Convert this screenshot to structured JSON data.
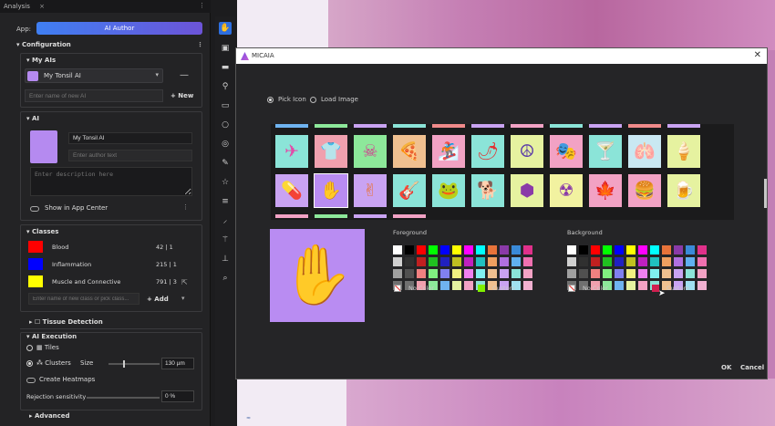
{
  "panel": {
    "title": "Analysis",
    "close": "×",
    "kebab": "⋮"
  },
  "app": {
    "label": "App:",
    "selected": "AI Author"
  },
  "configuration": {
    "title": "Configuration"
  },
  "my_ais": {
    "title": "My AIs",
    "selected_ai": "My Tonsil AI",
    "new_name_placeholder": "Enter name of new AI",
    "new_button": "+ New",
    "minus_glyph": "—"
  },
  "ai": {
    "title": "AI",
    "name_value": "My Tonsil AI",
    "author_placeholder": "Enter author text",
    "description_placeholder": "Enter description here",
    "show_in_app_center": "Show in App Center"
  },
  "classes": {
    "title": "Classes",
    "items": [
      {
        "name": "Blood",
        "count": "42 | 1",
        "color": "#ff0000"
      },
      {
        "name": "Inflammation",
        "count": "215 | 1",
        "color": "#0000ff"
      },
      {
        "name": "Muscle and Connective",
        "count": "791 | 3",
        "color": "#ffff00"
      }
    ],
    "new_class_placeholder": "Enter name of new class or pick class...",
    "add_button": "+ Add"
  },
  "tissue_detection": {
    "title": "Tissue Detection"
  },
  "ai_execution": {
    "title": "AI Execution",
    "tiles_label": "Tiles",
    "clusters_label": "Clusters",
    "size_label": "Size",
    "size_value": "130 µm",
    "heatmaps_label": "Create Heatmaps",
    "rejection_label": "Rejection sensitivity",
    "rejection_value": "0 %"
  },
  "advanced": {
    "title": "Advanced"
  },
  "dialog": {
    "title": "MICAIA",
    "close": "✕",
    "pick_icon": "Pick Icon",
    "load_image": "Load Image",
    "foreground_label": "Foreground",
    "background_label": "Background",
    "no_color": "No Color",
    "custom": "Custom",
    "ok": "OK",
    "cancel": "Cancel",
    "preview": {
      "icon": "hand-icon",
      "glyph": "✋",
      "background": "#b98cf2",
      "foreground": "#e8733a"
    },
    "strip_colors": [
      "#6fb3f0",
      "#8de89a",
      "#c9a3f2",
      "#8be4d8",
      "#f08a8a",
      "#c9a3f2",
      "#f2a2c4",
      "#8be4d8",
      "#c9a3f2",
      "#f08a8a",
      "#c9a3f2"
    ],
    "bottom_strip_colors": [
      "#f2a2c4",
      "#8de89a",
      "#c9a3f2",
      "#f2a2c4"
    ],
    "icons_row1": [
      {
        "name": "jet-icon",
        "glyph": "✈",
        "bg": "#8be4d8",
        "fg": "#e24ba8"
      },
      {
        "name": "shirt-icon",
        "glyph": "👕",
        "bg": "#f0a0ae",
        "fg": "#6dd6e0"
      },
      {
        "name": "skull-crossbones-icon",
        "glyph": "☠",
        "bg": "#8de89a",
        "fg": "#d6338f"
      },
      {
        "name": "pizza-icon",
        "glyph": "🍕",
        "bg": "#f0c090",
        "fg": "#3aa0e8"
      },
      {
        "name": "snowboarder-icon",
        "glyph": "🏂",
        "bg": "#f2a2c4",
        "fg": "#5fe0b8"
      },
      {
        "name": "chili-pepper-icon",
        "glyph": "🌶",
        "bg": "#8be4d8",
        "fg": "#e23030"
      },
      {
        "name": "peace-icon",
        "glyph": "☮",
        "bg": "#e6f2a0",
        "fg": "#5a3aa8"
      },
      {
        "name": "theater-masks-icon",
        "glyph": "🎭",
        "bg": "#f2a2c4",
        "fg": "#3ac06a"
      },
      {
        "name": "cocktail-icon",
        "glyph": "🍸",
        "bg": "#8be4d8",
        "fg": "#e02a4a"
      },
      {
        "name": "lungs-icon",
        "glyph": "🫁",
        "bg": "#c9e8f2",
        "fg": "#e0303a"
      },
      {
        "name": "ice-cream-icon",
        "glyph": "🍦",
        "bg": "#e6f2a0",
        "fg": "#c040c0"
      }
    ],
    "icons_row2": [
      {
        "name": "pills-icon",
        "glyph": "💊",
        "bg": "#c9a3f2",
        "fg": "#5ad06a"
      },
      {
        "name": "hand-icon",
        "glyph": "✋",
        "bg": "#b98cf2",
        "fg": "#3ac06a",
        "selected": true
      },
      {
        "name": "peace-hand-icon",
        "glyph": "✌",
        "bg": "#c9a3f2",
        "fg": "#e8733a"
      },
      {
        "name": "guitar-icon",
        "glyph": "🎸",
        "bg": "#8be4d8",
        "fg": "#e23030"
      },
      {
        "name": "frog-icon",
        "glyph": "🐸",
        "bg": "#8be4d8",
        "fg": "#e0308a"
      },
      {
        "name": "dog-icon",
        "glyph": "🐕",
        "bg": "#8be4d8",
        "fg": "#e23030"
      },
      {
        "name": "cubes-icon",
        "glyph": "⬢",
        "bg": "#e6f2a0",
        "fg": "#8a3aa8"
      },
      {
        "name": "radiation-icon",
        "glyph": "☢",
        "bg": "#f2f2a0",
        "fg": "#8a3aa8"
      },
      {
        "name": "cannabis-icon",
        "glyph": "🍁",
        "bg": "#f2a2c4",
        "fg": "#3ac03a"
      },
      {
        "name": "burger-icon",
        "glyph": "🍔",
        "bg": "#f2a2c4",
        "fg": "#d8a030"
      },
      {
        "name": "mug-icon",
        "glyph": "🍺",
        "bg": "#e6f2a0",
        "fg": "#5a3ad8"
      }
    ],
    "palette_colors": [
      "#ffffff",
      "#000000",
      "#ff0000",
      "#00ff00",
      "#0000ff",
      "#ffff00",
      "#ff00ff",
      "#00ffff",
      "#e8733a",
      "#8a3aa8",
      "#3a8ad8",
      "#e0308a",
      "#d0d0d0",
      "#303030",
      "#c02020",
      "#20c020",
      "#2020c0",
      "#c0c020",
      "#c020c0",
      "#20c0c0",
      "#f0a060",
      "#b070e0",
      "#60b0f0",
      "#f070b0",
      "#a0a0a0",
      "#505050",
      "#f08080",
      "#80f080",
      "#8080f0",
      "#f0f080",
      "#f080f0",
      "#80f0f0",
      "#f0c090",
      "#c9a3f2",
      "#8be4d8",
      "#f2a2c4",
      "#707070",
      "#707070",
      "#f0a0ae",
      "#8de89a",
      "#6fb3f0",
      "#e6f2a0",
      "#f2a2c4",
      "#8be4d8",
      "#f0c090",
      "#c9a3f2",
      "#a0e0f0",
      "#f0b0d0"
    ],
    "fg_custom_color": "#80f000",
    "bg_custom_color": "#d02050"
  }
}
